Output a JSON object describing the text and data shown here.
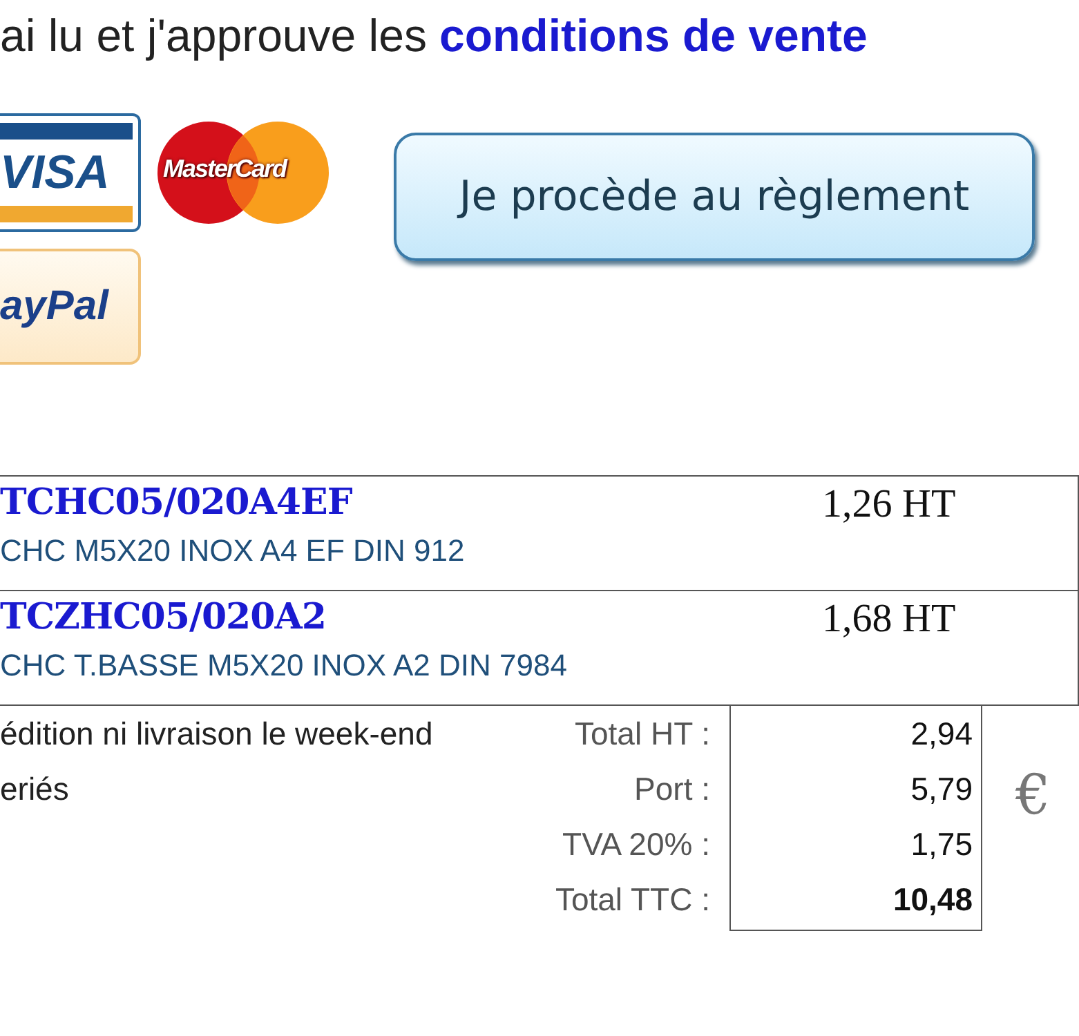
{
  "terms": {
    "text": "ai lu et j'approuve les",
    "link": "conditions de vente"
  },
  "payment_logos": [
    {
      "kind": "visa",
      "text": "VISA"
    },
    {
      "kind": "mastercard",
      "text": "MasterCard"
    },
    {
      "kind": "paypal",
      "text": "ayPal"
    }
  ],
  "pay_button": "Je procède au règlement",
  "items": [
    {
      "code": "TCHC05/020A4EF",
      "description": "CHC M5X20 INOX A4 EF DIN 912",
      "price": "1,26 HT"
    },
    {
      "code": "TCZHC05/020A2",
      "description": "CHC T.BASSE M5X20 INOX A2 DIN 7984",
      "price": "1,68 HT"
    }
  ],
  "notes": [
    "édition ni livraison le week-end",
    "eriés"
  ],
  "totals": [
    {
      "label": "Total HT :",
      "value": "2,94",
      "bold": false
    },
    {
      "label": "Port :",
      "value": "5,79",
      "bold": false
    },
    {
      "label": "TVA 20% :",
      "value": "1,75",
      "bold": false
    },
    {
      "label": "Total TTC :",
      "value": "10,48",
      "bold": true
    }
  ],
  "currency": "€"
}
